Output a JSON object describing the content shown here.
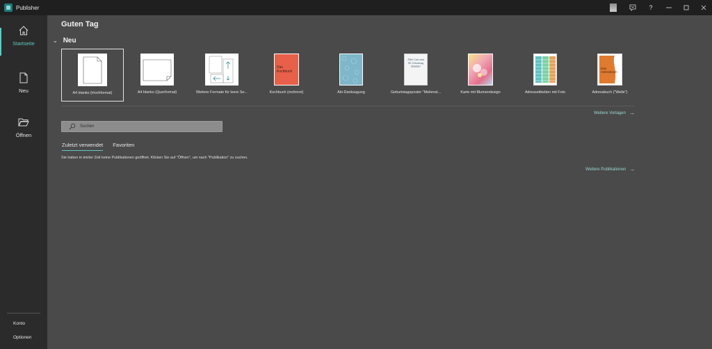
{
  "app": {
    "title": "Publisher"
  },
  "titlebar": {
    "buttons": [
      "feedback",
      "help",
      "minimize",
      "restore",
      "close"
    ]
  },
  "sidebar": {
    "items": [
      {
        "label": "Startseite",
        "icon": "home-icon",
        "active": true
      },
      {
        "label": "Neu",
        "icon": "new-document-icon",
        "active": false
      },
      {
        "label": "Öffnen",
        "icon": "folder-open-icon",
        "active": false
      }
    ],
    "bottom": {
      "account": "Konto",
      "options": "Optionen"
    }
  },
  "main": {
    "greeting": "Guten Tag",
    "section_new": "Neu",
    "templates": [
      {
        "label": "A4 blanko (Hochformat)",
        "selected": true
      },
      {
        "label": "A4 blanko (Querformat)"
      },
      {
        "label": "Weitere Formate für leere Se..."
      },
      {
        "label": "Kochbuch (mohnrot)",
        "thumb_text": "Das Kochbuch",
        "color": "#e8604a"
      },
      {
        "label": "Abi-Danksagung",
        "color": "#7fb6c9"
      },
      {
        "label": "Geburtstagsposter \"Meilenst...",
        "thumb_text": "Alles Gute zum 60. Geburtstag MAMA!"
      },
      {
        "label": "Karte mit Blumendesign",
        "color": "#f0a6b5"
      },
      {
        "label": "Adressetiketten mit Foto",
        "color": "#5bc3c0"
      },
      {
        "label": "Adressbuch (\"Welle\")",
        "thumb_text": "Das Adressbuch",
        "color": "#e07a2e"
      }
    ],
    "more_templates": "Weitere Vorlagen",
    "search_placeholder": "Suchen",
    "tabs": [
      {
        "label": "Zuletzt verwendet",
        "active": true
      },
      {
        "label": "Favoriten",
        "active": false
      }
    ],
    "empty_message": "Sie haben in letzter Zeit keine Publikationen geöffnet. Klicken Sie auf \"Öffnen\", um nach \"Publikation\" zu suchen.",
    "more_publications": "Weitere Publikationen"
  }
}
